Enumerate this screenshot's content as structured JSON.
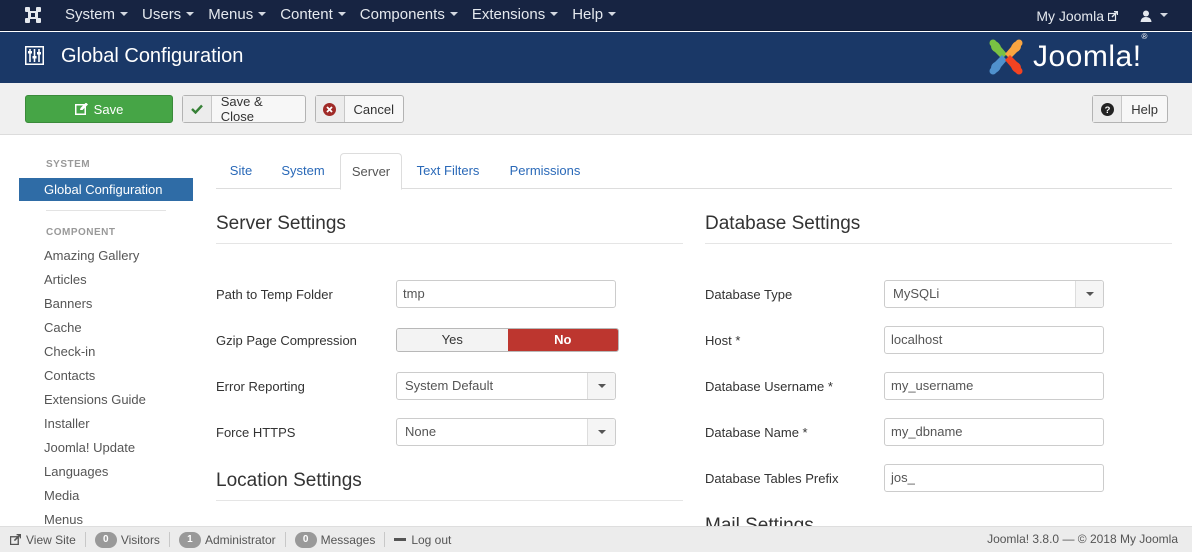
{
  "navbar": {
    "menu": [
      {
        "label": "System"
      },
      {
        "label": "Users"
      },
      {
        "label": "Menus"
      },
      {
        "label": "Content"
      },
      {
        "label": "Components"
      },
      {
        "label": "Extensions"
      },
      {
        "label": "Help"
      }
    ],
    "my_joomla": "My Joomla",
    "user_icon": "user-icon"
  },
  "header": {
    "title": "Global Configuration",
    "icon": "equalizer-icon",
    "brand": "Joomla!",
    "brand_reg": "®"
  },
  "toolbar": {
    "save": "Save",
    "save_close": "Save & Close",
    "cancel": "Cancel",
    "help": "Help"
  },
  "sidebar": {
    "system_heading": "SYSTEM",
    "active_item": "Global Configuration",
    "component_heading": "COMPONENT",
    "items": [
      "Amazing Gallery",
      "Articles",
      "Banners",
      "Cache",
      "Check-in",
      "Contacts",
      "Extensions Guide",
      "Installer",
      "Joomla! Update",
      "Languages",
      "Media",
      "Menus"
    ]
  },
  "tabs": [
    {
      "label": "Site"
    },
    {
      "label": "System"
    },
    {
      "label": "Server",
      "active": true
    },
    {
      "label": "Text Filters"
    },
    {
      "label": "Permissions"
    }
  ],
  "server": {
    "title": "Server Settings",
    "temp_label": "Path to Temp Folder",
    "temp_value": "tmp",
    "gzip_label": "Gzip Page Compression",
    "gzip_yes": "Yes",
    "gzip_no": "No",
    "gzip_selected": "No",
    "error_label": "Error Reporting",
    "error_value": "System Default",
    "https_label": "Force HTTPS",
    "https_value": "None"
  },
  "location": {
    "title": "Location Settings"
  },
  "database": {
    "title": "Database Settings",
    "type_label": "Database Type",
    "type_value": "MySQLi",
    "host_label": "Host *",
    "host_value": "localhost",
    "user_label": "Database Username *",
    "user_value": "my_username",
    "name_label": "Database Name *",
    "name_value": "my_dbname",
    "prefix_label": "Database Tables Prefix",
    "prefix_value": "jos_"
  },
  "mail": {
    "title": "Mail Settings"
  },
  "statusbar": {
    "view_site": "View Site",
    "visitors_count": "0",
    "visitors": "Visitors",
    "admin_count": "1",
    "admin": "Administrator",
    "messages_count": "0",
    "messages": "Messages",
    "logout": "Log out",
    "version": "Joomla! 3.8.0  —  © 2018 My Joomla"
  },
  "colors": {
    "navbar_bg": "#172442",
    "header_bg": "#1a3867",
    "save_green": "#46a546",
    "active_blue": "#2f6ca6",
    "toggle_no_red": "#bd362f",
    "link_blue": "#2a69b8"
  }
}
